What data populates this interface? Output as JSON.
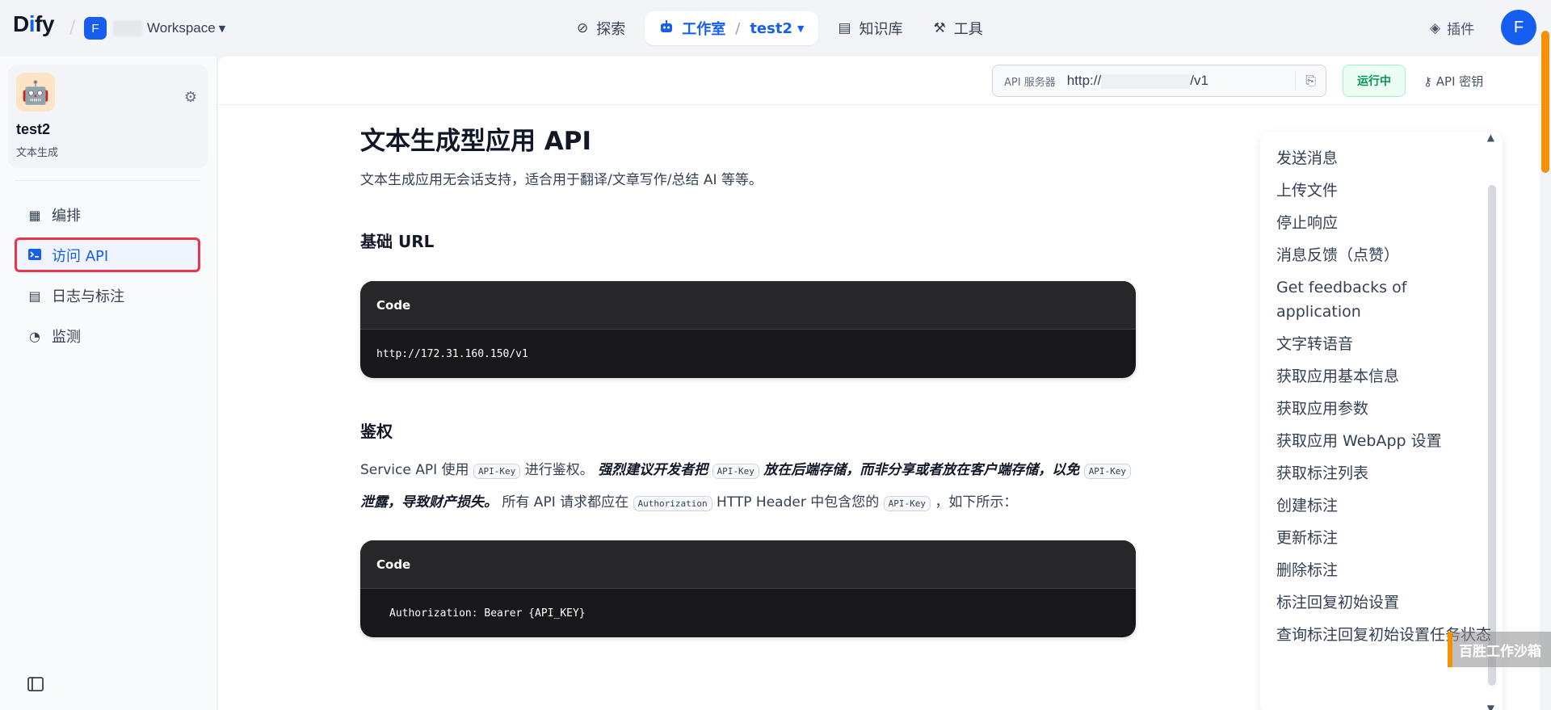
{
  "brand": {
    "logo_text_a": "D",
    "logo_text_i": "i",
    "logo_text_b": "fy"
  },
  "workspace": {
    "avatar_letter": "F",
    "name": "Workspace"
  },
  "nav": {
    "explore": "探索",
    "studio": "工作室",
    "current_app": "test2",
    "knowledge": "知识库",
    "tools": "工具"
  },
  "header_right": {
    "plugins": "插件",
    "user_initial": "F"
  },
  "app": {
    "name": "test2",
    "type": "文本生成"
  },
  "sidebar": {
    "items": [
      {
        "label": "编排",
        "icon": "layout-icon"
      },
      {
        "label": "访问 API",
        "icon": "terminal-icon"
      },
      {
        "label": "日志与标注",
        "icon": "log-icon"
      },
      {
        "label": "监测",
        "icon": "gauge-icon"
      }
    ]
  },
  "api_bar": {
    "server_label": "API 服务器",
    "server_url_prefix": "http://",
    "server_url_suffix": "/v1",
    "status": "运行中",
    "api_key": "API 密钥"
  },
  "doc": {
    "title": "文本生成型应用 API",
    "subtitle": "文本生成应用无会话支持，适合用于翻译/文章写作/总结 AI 等等。",
    "base_url_heading": "基础 URL",
    "code1_label": "Code",
    "code1_body": "http://172.31.160.150/v1",
    "auth_heading": "鉴权",
    "auth_p1": "Service API 使用",
    "auth_tag1": "API-Key",
    "auth_p2": "进行鉴权。",
    "auth_em1": "强烈建议开发者把",
    "auth_tag2": "API-Key",
    "auth_em2": "放在后端存储，而非分享或者放在客户端存储，以免",
    "auth_tag3": "API-Key",
    "auth_em3": "泄露，导致财产损失。",
    "auth_p3": "所有 API 请求都应在",
    "auth_tag4": "Authorization",
    "auth_p4": "HTTP Header 中包含您的",
    "auth_tag5": "API-Key",
    "auth_p5": "，如下所示：",
    "code2_label": "Code",
    "code2_body": "Authorization: Bearer {API_KEY}"
  },
  "toc": {
    "items": [
      "发送消息",
      "上传文件",
      "停止响应",
      "消息反馈（点赞）",
      "Get feedbacks of application",
      "文字转语音",
      "获取应用基本信息",
      "获取应用参数",
      "获取应用 WebApp 设置",
      "获取标注列表",
      "创建标注",
      "更新标注",
      "删除标注",
      "标注回复初始设置",
      "查询标注回复初始设置任务状态"
    ]
  },
  "overlay": {
    "sandbox": "百胜工作沙箱"
  },
  "colors": {
    "accent": "#155eef",
    "highlight_border": "#e9364b",
    "status_green": "#079455",
    "sandbox_orange": "#f79009"
  }
}
